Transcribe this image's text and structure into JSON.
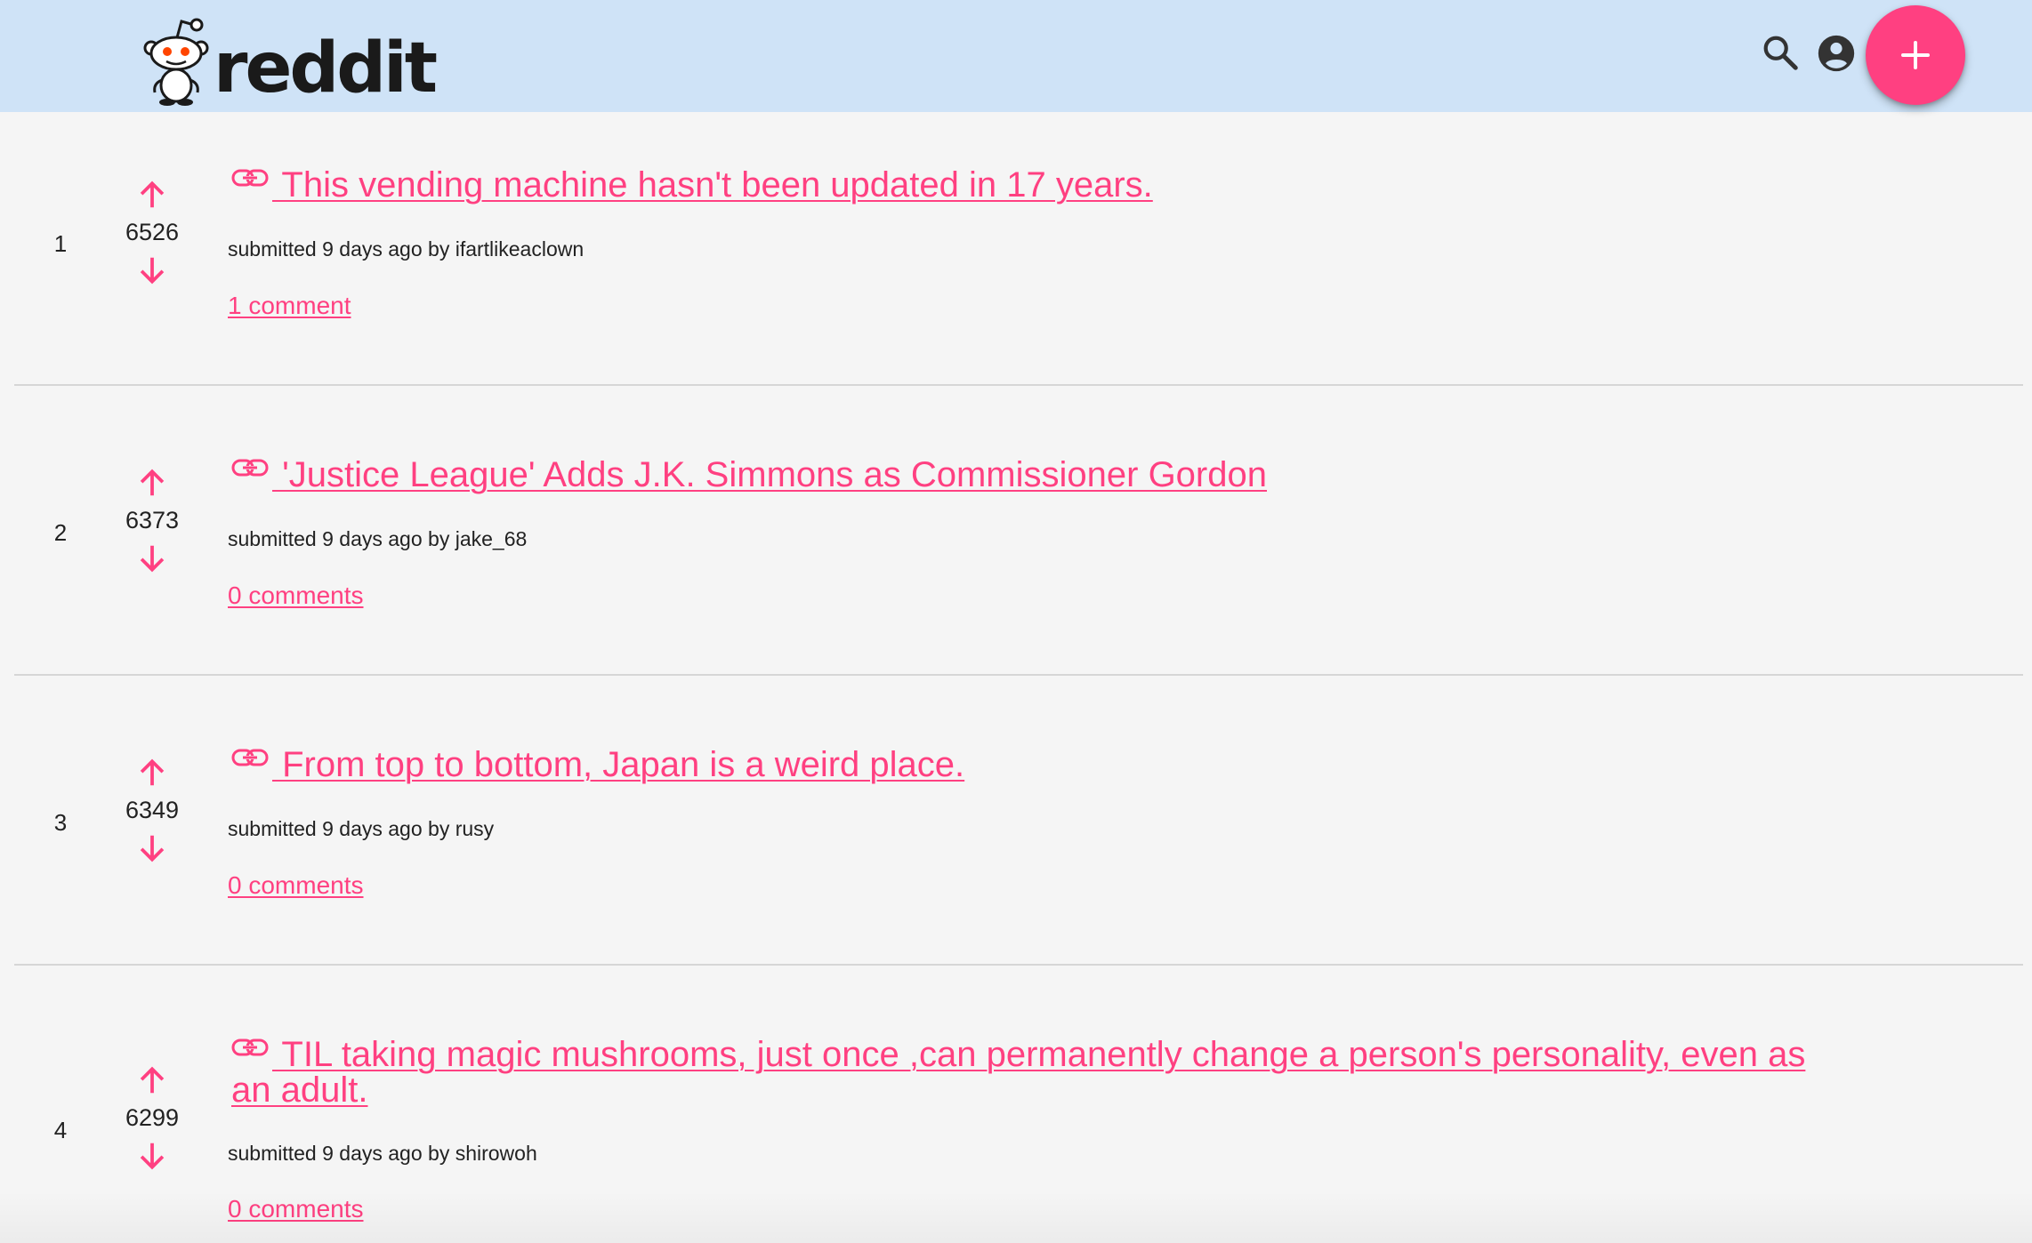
{
  "header": {
    "logo_text": "reddit",
    "accent_color": "#ff4081",
    "bar_color": "#cfe3f7",
    "icons": [
      "search-icon",
      "account-icon",
      "plus-icon"
    ]
  },
  "posts": [
    {
      "rank": "1",
      "score": "6526",
      "title": " This vending machine hasn't been updated in 17 years.",
      "meta": "submitted 9 days ago by ifartlikeaclown",
      "comments": "1 comment"
    },
    {
      "rank": "2",
      "score": "6373",
      "title": " 'Justice League' Adds J.K. Simmons as Commissioner Gordon",
      "meta": "submitted 9 days ago by jake_68",
      "comments": "0 comments"
    },
    {
      "rank": "3",
      "score": "6349",
      "title": " From top to bottom, Japan is a weird place.",
      "meta": "submitted 9 days ago by rusy",
      "comments": "0 comments"
    },
    {
      "rank": "4",
      "score": "6299",
      "title": " TIL taking magic mushrooms, just once ,can permanently change a person's personality, even as an adult.",
      "meta": "submitted 9 days ago by shirowoh",
      "comments": "0 comments"
    }
  ]
}
